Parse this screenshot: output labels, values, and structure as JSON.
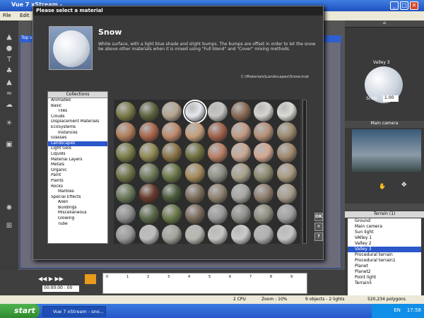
{
  "window": {
    "title": "Vue 7 xStream - ",
    "menu": [
      "File",
      "Edit"
    ]
  },
  "viewport": {
    "title": "Top vi"
  },
  "dialog": {
    "title": "Please select a material",
    "material_name": "Snow",
    "description": "White surface, with a light blue shade and slight bumps. The bumps are offset in order to let the snow be above other materials when it is mixed using \"Full blend\" and \"Cover\" mixing methods.",
    "path": "C:\\Materials\\Landscapes\\Snow.mat",
    "collections_header": "Collections",
    "collections": [
      {
        "label": "Animated",
        "indent": 0
      },
      {
        "label": "Basic",
        "indent": 0
      },
      {
        "label": "Tiles",
        "indent": 1
      },
      {
        "label": "Clouds",
        "indent": 0
      },
      {
        "label": "Displacement Materials",
        "indent": 0
      },
      {
        "label": "EcoSystems",
        "indent": 0
      },
      {
        "label": "Instances",
        "indent": 1
      },
      {
        "label": "Glasses",
        "indent": 0
      },
      {
        "label": "Landscapes",
        "indent": 0,
        "selected": true
      },
      {
        "label": "Light Gels",
        "indent": 0
      },
      {
        "label": "Liquids",
        "indent": 0
      },
      {
        "label": "Material Layers",
        "indent": 0
      },
      {
        "label": "Metals",
        "indent": 0
      },
      {
        "label": "Organic",
        "indent": 0
      },
      {
        "label": "Paint",
        "indent": 0
      },
      {
        "label": "Plants",
        "indent": 0
      },
      {
        "label": "Rocks",
        "indent": 0
      },
      {
        "label": "Marbles",
        "indent": 1
      },
      {
        "label": "Special Effects",
        "indent": 0
      },
      {
        "label": "Alien",
        "indent": 1
      },
      {
        "label": "Buildings",
        "indent": 1
      },
      {
        "label": "Miscellaneous",
        "indent": 1
      },
      {
        "label": "Glowing",
        "indent": 1
      },
      {
        "label": "Tube",
        "indent": 1
      }
    ],
    "buttons": {
      "ok": "OK",
      "cancel": "✕",
      "help": "?"
    },
    "swatch_colors": [
      "#7d7a4a",
      "#5f6440",
      "#b5a58f",
      "#e6e8ee",
      "#c6c5c2",
      "#8a6a55",
      "#d7d4d0",
      "#dcdad6",
      "#b27d5a",
      "#a9654a",
      "#c08a6a",
      "#c59f7c",
      "#a2624a",
      "#c29a82",
      "#b59077",
      "#9c8a6e",
      "#7c7f4a",
      "#8f8952",
      "#8a7448",
      "#6f7040",
      "#b98064",
      "#c8a891",
      "#d2a891",
      "#a2886e",
      "#717448",
      "#6e7a5a",
      "#6a7748",
      "#a58a5a",
      "#8e8e84",
      "#a8a08a",
      "#8c8a6e",
      "#a89a80",
      "#6a7a5a",
      "#6a3b2b",
      "#4a5a3a",
      "#7e6e5a",
      "#8f8270",
      "#a6a6a0",
      "#8e7e6e",
      "#a59a8a",
      "#8e8e8e",
      "#5a6a4a",
      "#6a7a4a",
      "#7a6a5a",
      "#9a9a9a",
      "#8e8e8a",
      "#8e8e80",
      "#a0a0a0",
      "#9a9a9a",
      "#bdbdbd",
      "#a3a39a",
      "#b6b6b0",
      "#c4c4c0",
      "#cacaca",
      "#b0b0b0",
      "#c5c5c5"
    ]
  },
  "right_panel": {
    "material_label": "Valley 3",
    "scale_label": "Scale",
    "scale_value": "1.00",
    "camera_label": "Main camera",
    "terrain_header": "Terrain (1)",
    "objects": [
      "Ground",
      "Main camera",
      "Sun light",
      "VAlley 1",
      "Valley 2",
      "Valley 3",
      "Procedural terrain",
      "Procedural terrain1",
      "Planet",
      "Planet2",
      "Point light",
      "Terrain5"
    ]
  },
  "timeline": {
    "time": "00:00:00 : 00",
    "ticks": [
      "0",
      "1",
      "2",
      "3",
      "4",
      "5",
      "6",
      "7",
      "8",
      "9"
    ]
  },
  "status": {
    "cpu": "2 CPU",
    "zoom": "Zoom : 10%",
    "objects": "9 objects - 2 lights",
    "polygons": "520,234 polygons"
  },
  "taskbar": {
    "start": "start",
    "task": "Vue 7 xStream - sno...",
    "lang": "EN",
    "clock": "17:58"
  }
}
